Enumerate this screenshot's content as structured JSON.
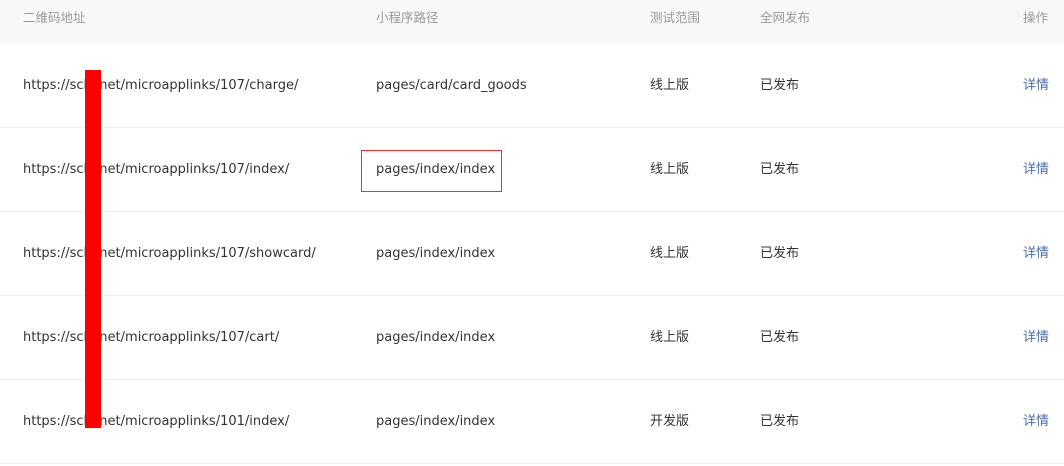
{
  "columns": {
    "url": "二维码地址",
    "path": "小程序路径",
    "scope": "测试范围",
    "status": "全网发布",
    "op": "操作"
  },
  "rows": [
    {
      "url": "https://sck   .net/microapplinks/107/charge/",
      "path": "pages/card/card_goods",
      "scope": "线上版",
      "status": "已发布",
      "op": "详情"
    },
    {
      "url": "https://sck   .net/microapplinks/107/index/",
      "path": "pages/index/index",
      "scope": "线上版",
      "status": "已发布",
      "op": "详情"
    },
    {
      "url": "https://sck   .net/microapplinks/107/showcard/",
      "path": "pages/index/index",
      "scope": "线上版",
      "status": "已发布",
      "op": "详情"
    },
    {
      "url": "https://sck   .net/microapplinks/107/cart/",
      "path": "pages/index/index",
      "scope": "线上版",
      "status": "已发布",
      "op": "详情"
    },
    {
      "url": "https://sck   .net/microapplinks/101/index/",
      "path": "pages/index/index",
      "scope": "开发版",
      "status": "已发布",
      "op": "详情"
    }
  ],
  "colors": {
    "header_bg": "#f7f8fa",
    "link": "#4a6ea6",
    "highlight": "#d9383a",
    "redaction": "#ff0000"
  }
}
